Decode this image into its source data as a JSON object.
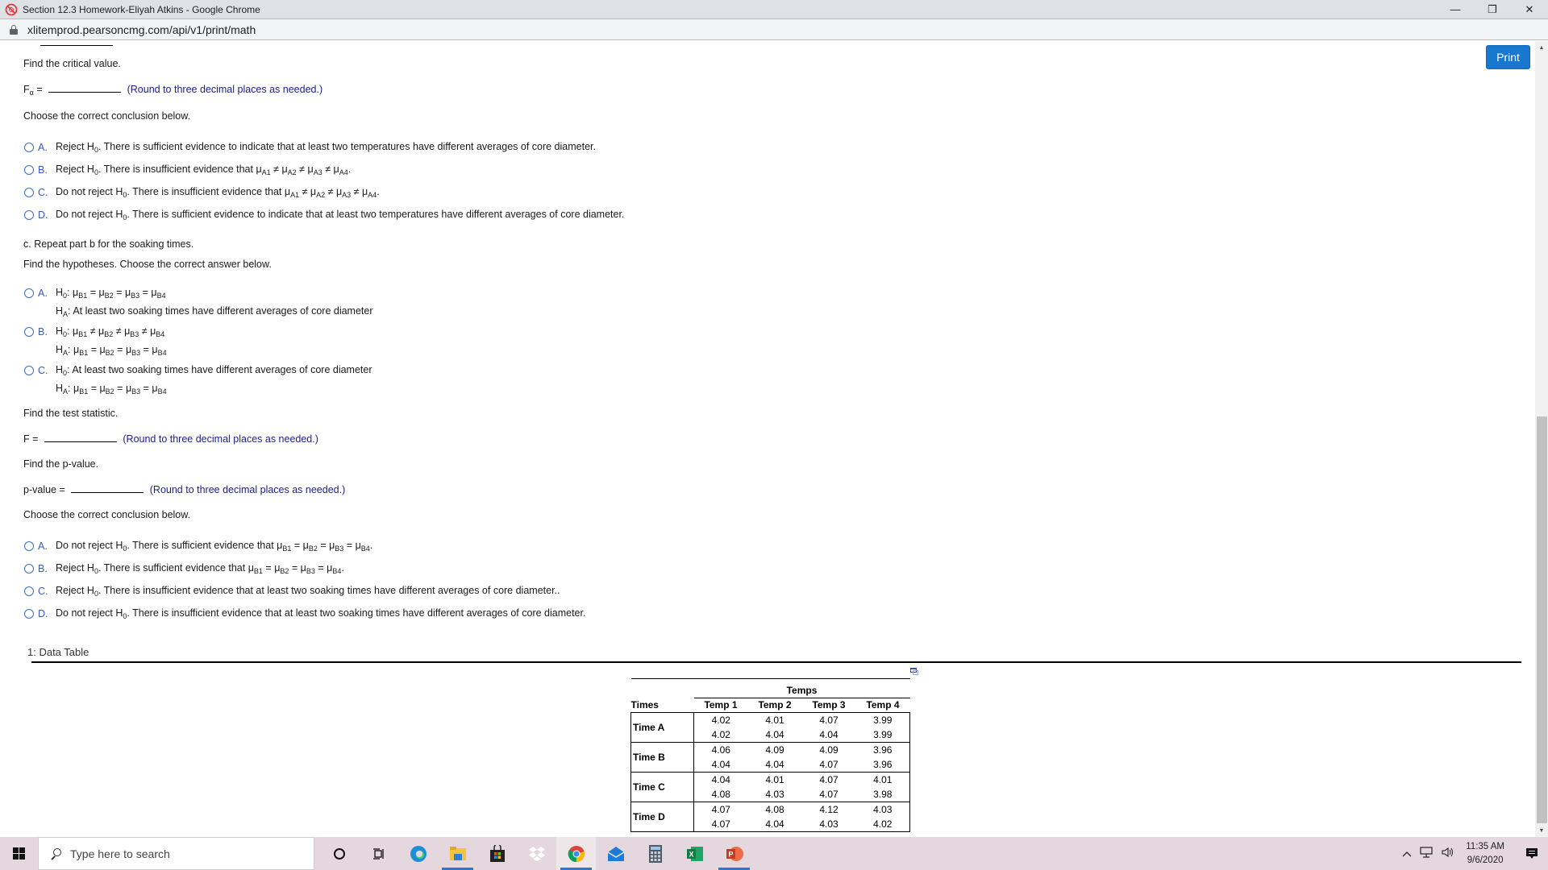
{
  "window": {
    "title": "Section 12.3 Homework-Eliyah Atkins - Google Chrome",
    "controls": {
      "minimize": "—",
      "restore": "❐",
      "close": "✕"
    }
  },
  "address_bar": {
    "url": "xlitemprod.pearsoncmg.com/api/v1/print/math"
  },
  "print_button": "Print",
  "critical_value": {
    "prompt": "Find the critical value.",
    "label": "F",
    "label_sub": "α",
    "equals": "=",
    "value": "",
    "hint": "(Round to three decimal places as needed.)"
  },
  "part_b_conclusion": {
    "prompt": "Choose the correct conclusion below.",
    "options": [
      {
        "letter": "A.",
        "pre": "Reject H",
        "sub": "0",
        "text": ". There is sufficient evidence to indicate that at least two temperatures have different averages of core diameter."
      },
      {
        "letter": "B.",
        "pre": "Reject H",
        "sub": "0",
        "text": ". There is insufficient evidence that ",
        "math": [
          [
            "μ",
            "A1"
          ],
          "≠",
          [
            "μ",
            "A2"
          ],
          "≠",
          [
            "μ",
            "A3"
          ],
          "≠",
          [
            "μ",
            "A4"
          ]
        ],
        "end": "."
      },
      {
        "letter": "C.",
        "pre": "Do not reject H",
        "sub": "0",
        "text": ". There is insufficient evidence that ",
        "math": [
          [
            "μ",
            "A1"
          ],
          "≠",
          [
            "μ",
            "A2"
          ],
          "≠",
          [
            "μ",
            "A3"
          ],
          "≠",
          [
            "μ",
            "A4"
          ]
        ],
        "end": "."
      },
      {
        "letter": "D.",
        "pre": "Do not reject H",
        "sub": "0",
        "text": ". There is sufficient evidence to indicate that at least two temperatures have different averages of core diameter."
      }
    ]
  },
  "part_c": {
    "heading": "c. Repeat part b for the soaking times.",
    "hypotheses_prompt": "Find the hypotheses. Choose the correct answer below.",
    "hypotheses_options": [
      {
        "letter": "A.",
        "h0": "μB1 = μB2 = μB3 = μB4",
        "ha": "At least two soaking times have different averages of core diameter"
      },
      {
        "letter": "B.",
        "h0": "μB1 ≠ μB2 ≠ μB3 ≠ μB4",
        "ha": "μB1 = μB2 = μB3 = μB4"
      },
      {
        "letter": "C.",
        "h0": "At least two soaking times have different averages of core diameter",
        "ha": "μB1 = μB2 = μB3 = μB4"
      }
    ],
    "test_statistic": {
      "prompt": "Find the test statistic.",
      "label": "F =",
      "value": "",
      "hint": "(Round to three decimal places as needed.)"
    },
    "p_value": {
      "prompt": "Find the p-value.",
      "label": "p-value =",
      "value": "",
      "hint": "(Round to three decimal places as needed.)"
    },
    "conclusion_prompt": "Choose the correct conclusion below.",
    "conclusion_options": [
      {
        "letter": "A.",
        "pre": "Do not reject H",
        "text": ". There is sufficient evidence that μB1 = μB2 = μB3 = μB4."
      },
      {
        "letter": "B.",
        "pre": "Reject H",
        "text": ". There is sufficient evidence that μB1 = μB2 = μB3 = μB4."
      },
      {
        "letter": "C.",
        "pre": "Reject H",
        "text": ". There is insufficient evidence that at least two soaking times have different averages of core diameter.."
      },
      {
        "letter": "D.",
        "pre": "Do not reject H",
        "text": ". There is insufficient evidence that at least two soaking times have different averages of core diameter."
      }
    ]
  },
  "data_table": {
    "label": "1: Data Table",
    "group_header": "Temps",
    "row_header": "Times",
    "columns": [
      "Temp 1",
      "Temp 2",
      "Temp 3",
      "Temp 4"
    ],
    "rows": [
      {
        "label": "Time A",
        "values": [
          [
            "4.02",
            "4.01",
            "4.07",
            "3.99"
          ],
          [
            "4.02",
            "4.04",
            "4.04",
            "3.99"
          ]
        ]
      },
      {
        "label": "Time B",
        "values": [
          [
            "4.06",
            "4.09",
            "4.09",
            "3.96"
          ],
          [
            "4.04",
            "4.04",
            "4.07",
            "3.96"
          ]
        ]
      },
      {
        "label": "Time C",
        "values": [
          [
            "4.04",
            "4.01",
            "4.07",
            "4.01"
          ],
          [
            "4.08",
            "4.03",
            "4.07",
            "3.98"
          ]
        ]
      },
      {
        "label": "Time D",
        "values": [
          [
            "4.07",
            "4.08",
            "4.12",
            "4.03"
          ],
          [
            "4.07",
            "4.04",
            "4.03",
            "4.02"
          ]
        ]
      }
    ]
  },
  "taskbar": {
    "search_placeholder": "Type here to search",
    "apps": [
      "cortana",
      "task-view",
      "edge",
      "file-explorer",
      "store",
      "dropbox",
      "chrome",
      "mail",
      "calculator",
      "excel",
      "powerpoint"
    ],
    "clock_time": "11:35 AM",
    "clock_date": "9/6/2020"
  }
}
